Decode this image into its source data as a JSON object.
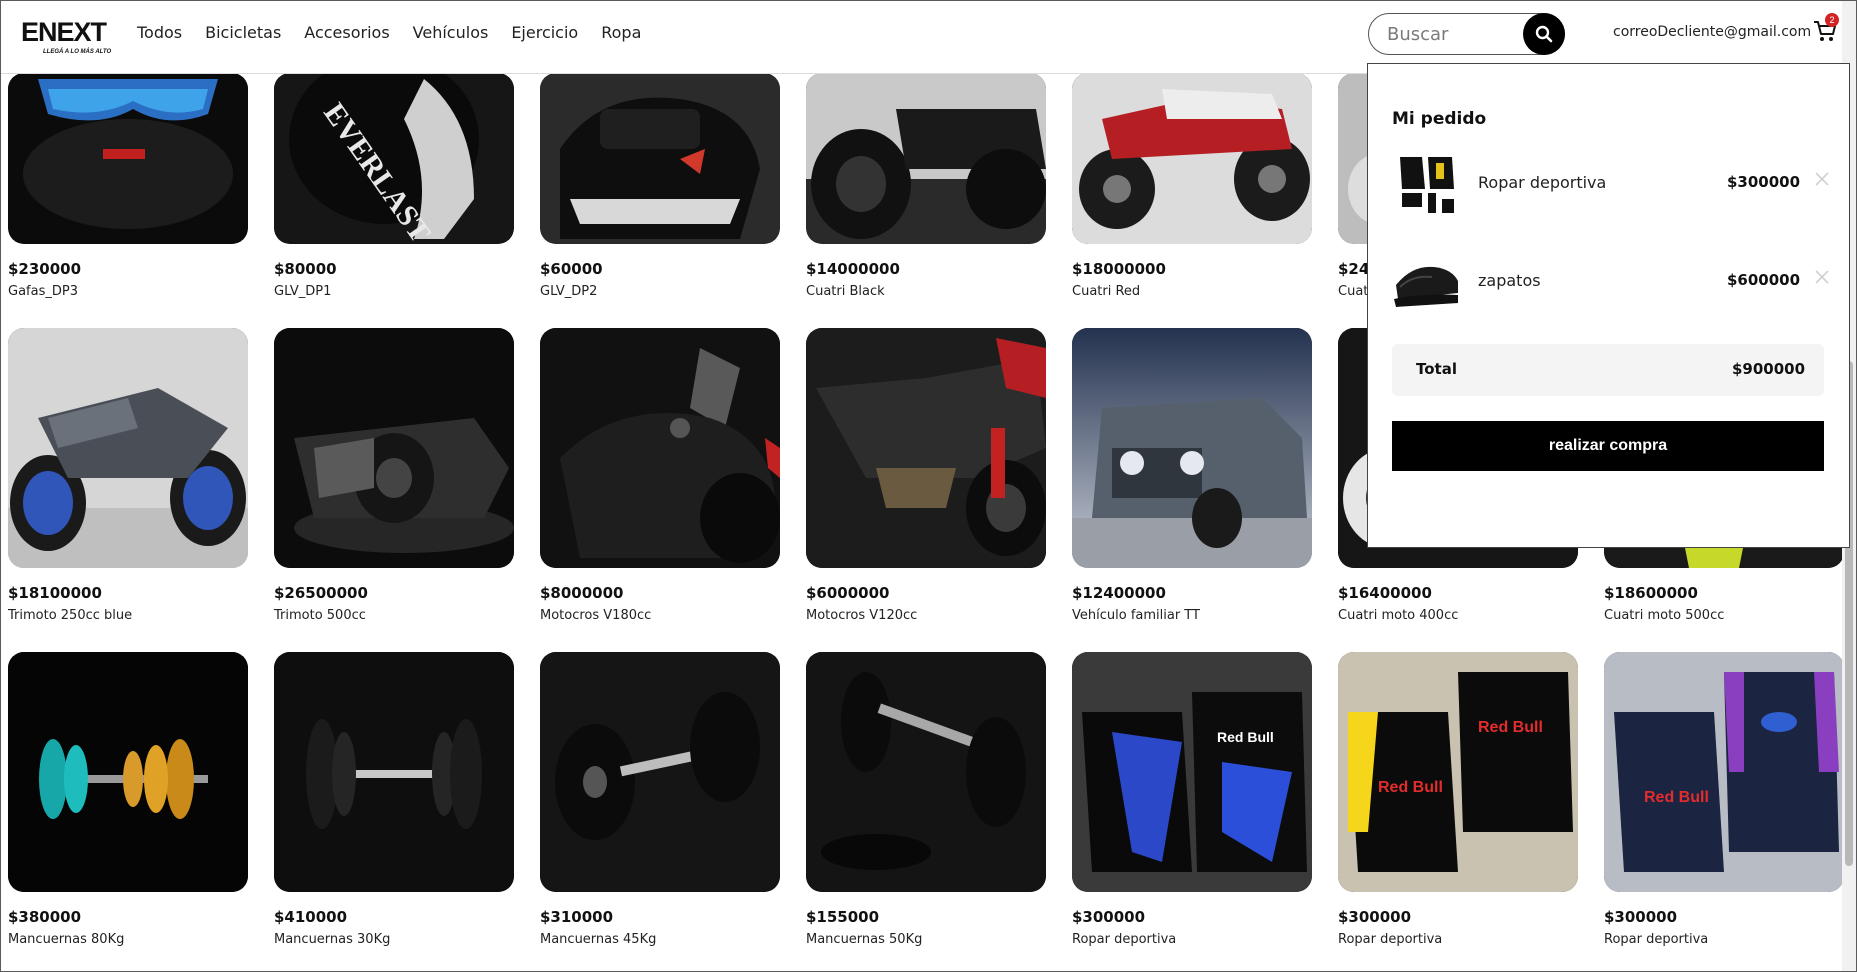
{
  "brand": {
    "name": "ENEXT",
    "tagline": "LLEGÁ A LO MÁS ALTO"
  },
  "nav": [
    "Todos",
    "Bicicletas",
    "Accesorios",
    "Vehículos",
    "Ejercicio",
    "Ropa"
  ],
  "search": {
    "placeholder": "Buscar"
  },
  "user": {
    "email": "correoDecliente@gmail.com"
  },
  "cart": {
    "count": "2"
  },
  "products_row1": [
    {
      "price": "$230000",
      "name": "Gafas_DP3"
    },
    {
      "price": "$80000",
      "name": "GLV_DP1"
    },
    {
      "price": "$60000",
      "name": "GLV_DP2"
    },
    {
      "price": "$14000000",
      "name": "Cuatri Black"
    },
    {
      "price": "$18000000",
      "name": "Cuatri Red"
    },
    {
      "price": "$24",
      "name": "Cuat"
    }
  ],
  "products_row2": [
    {
      "price": "$18100000",
      "name": "Trimoto 250cc blue"
    },
    {
      "price": "$26500000",
      "name": "Trimoto 500cc"
    },
    {
      "price": "$8000000",
      "name": "Motocros V180cc"
    },
    {
      "price": "$6000000",
      "name": "Motocros V120cc"
    },
    {
      "price": "$12400000",
      "name": "Vehículo familiar TT"
    },
    {
      "price": "$16400000",
      "name": "Cuatri moto 400cc"
    },
    {
      "price": "$18600000",
      "name": "Cuatri moto 500cc"
    }
  ],
  "products_row3": [
    {
      "price": "$380000",
      "name": "Mancuernas 80Kg"
    },
    {
      "price": "$410000",
      "name": "Mancuernas 30Kg"
    },
    {
      "price": "$310000",
      "name": "Mancuernas 45Kg"
    },
    {
      "price": "$155000",
      "name": "Mancuernas 50Kg"
    },
    {
      "price": "$300000",
      "name": "Ropar deportiva"
    },
    {
      "price": "$300000",
      "name": "Ropar deportiva"
    },
    {
      "price": "$300000",
      "name": "Ropar deportiva"
    }
  ],
  "order": {
    "title": "Mi pedido",
    "items": [
      {
        "name": "Ropar deportiva",
        "price": "$300000"
      },
      {
        "name": "zapatos",
        "price": "$600000"
      }
    ],
    "total_label": "Total",
    "total_value": "$900000",
    "buy_label": "realizar compra"
  },
  "colors": {
    "accent": "#000000",
    "badge": "#d12525"
  }
}
